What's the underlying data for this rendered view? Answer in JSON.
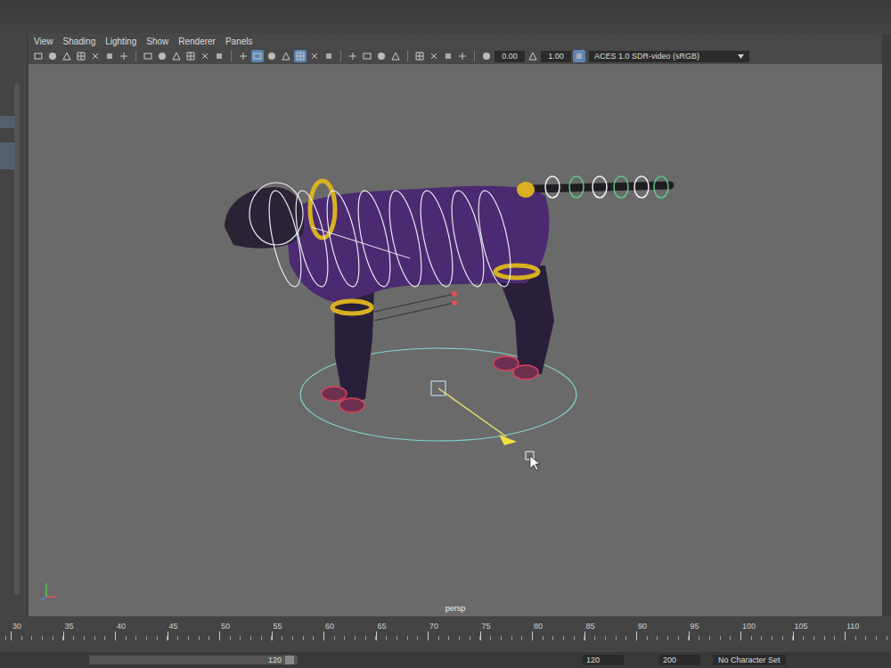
{
  "menu": [
    "View",
    "Shading",
    "Lighting",
    "Show",
    "Renderer",
    "Panels"
  ],
  "toolbar": {
    "groups": [
      [
        {
          "selected": false
        },
        {
          "selected": false
        },
        {
          "selected": false
        },
        {
          "selected": false
        },
        {
          "selected": false
        },
        {
          "selected": false
        },
        {
          "selected": false
        }
      ],
      [
        {
          "selected": false
        },
        {
          "selected": false
        },
        {
          "selected": false
        },
        {
          "selected": false
        },
        {
          "selected": false
        },
        {
          "selected": false
        }
      ],
      [
        {
          "selected": false
        },
        {
          "selected": true
        },
        {
          "selected": false
        },
        {
          "selected": false
        },
        {
          "selected": true
        },
        {
          "selected": false
        },
        {
          "selected": false
        }
      ],
      [
        {
          "selected": false
        },
        {
          "selected": false
        },
        {
          "selected": false
        },
        {
          "selected": false
        }
      ],
      [
        {
          "selected": false
        },
        {
          "selected": false
        },
        {
          "selected": false
        },
        {
          "selected": false
        }
      ]
    ],
    "exposure": "0.00",
    "gamma": "1.00",
    "color_space": "ACES 1.0 SDR-video (sRGB)",
    "color_space_on": true
  },
  "viewport": {
    "camera": "persp"
  },
  "timeline": {
    "ticks": [
      "30",
      "35",
      "40",
      "45",
      "50",
      "55",
      "60",
      "65",
      "70",
      "75",
      "80",
      "85",
      "90",
      "95",
      "100",
      "105",
      "110"
    ]
  },
  "range": {
    "start": "120",
    "end": "120",
    "max": "200",
    "character_set": "No Character Set"
  }
}
